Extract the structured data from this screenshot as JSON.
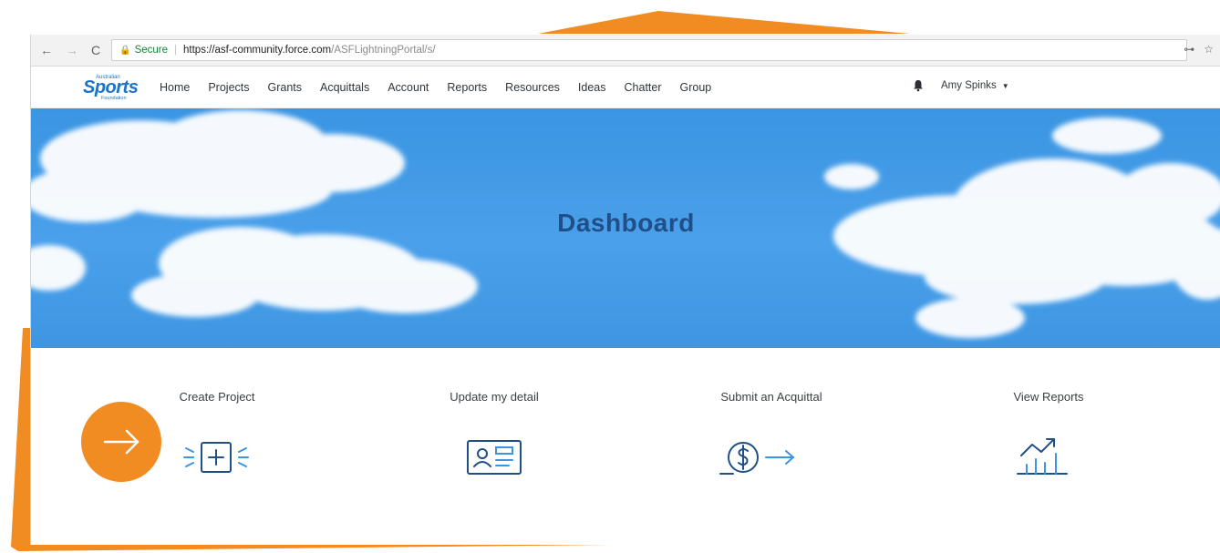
{
  "browser": {
    "nav": {
      "back": "←",
      "forward": "→",
      "reload": "C"
    },
    "secure_label": "Secure",
    "url_host": "https://asf-community.force.com",
    "url_path": "/ASFLightningPortal/s/",
    "key_icon": "key-icon",
    "star_icon": "star-icon"
  },
  "site": {
    "logo": {
      "top": "Australian",
      "main": "Sports",
      "bottom": "Foundation"
    },
    "nav": [
      {
        "label": "Home"
      },
      {
        "label": "Projects"
      },
      {
        "label": "Grants"
      },
      {
        "label": "Acquittals"
      },
      {
        "label": "Account"
      },
      {
        "label": "Reports"
      },
      {
        "label": "Resources"
      },
      {
        "label": "Ideas"
      },
      {
        "label": "Chatter"
      },
      {
        "label": "Group"
      }
    ],
    "user": {
      "name": "Amy Spinks",
      "bell_icon": "bell-icon"
    }
  },
  "hero": {
    "title": "Dashboard"
  },
  "actions": [
    {
      "label": "Create Project",
      "icon": "add-project-icon"
    },
    {
      "label": "Update my detail",
      "icon": "contact-card-icon"
    },
    {
      "label": "Submit an Acquittal",
      "icon": "dollar-arrow-icon"
    },
    {
      "label": "View Reports",
      "icon": "trend-chart-icon"
    }
  ],
  "colors": {
    "accent": "#f08c22",
    "brand": "#1b74c9",
    "hero": "#4aa0ea",
    "icon": "#1f4f86"
  }
}
